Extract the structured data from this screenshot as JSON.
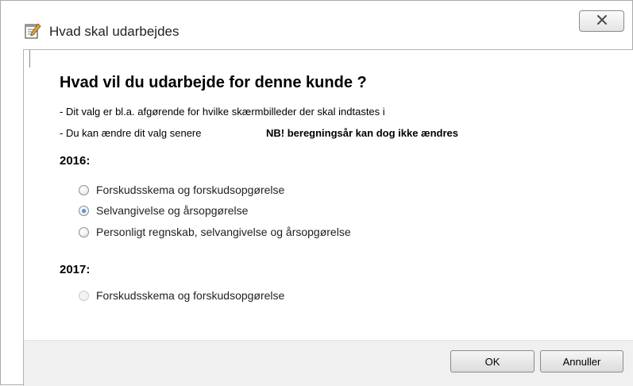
{
  "window": {
    "title": "Hvad skal udarbejdes",
    "close_icon": "close-icon",
    "app_icon": "notepad-edit-icon"
  },
  "content": {
    "heading": "Hvad vil du udarbejde for denne kunde ?",
    "info_line1": "- Dit valg er bl.a. afgørende for hvilke skærmbilleder der skal indtastes i",
    "info_line2": "- Du kan ændre dit valg senere",
    "nb_note": "NB! beregningsår kan dog ikke ændres"
  },
  "years": [
    {
      "label": "2016:",
      "options": [
        {
          "label": "Forskudsskema og forskudsopgørelse",
          "selected": false,
          "enabled": true
        },
        {
          "label": "Selvangivelse og årsopgørelse",
          "selected": true,
          "enabled": true
        },
        {
          "label": "Personligt regnskab, selvangivelse og årsopgørelse",
          "selected": false,
          "enabled": true
        }
      ]
    },
    {
      "label": "2017:",
      "options": [
        {
          "label": "Forskudsskema og forskudsopgørelse",
          "selected": false,
          "enabled": false
        }
      ]
    }
  ],
  "buttons": {
    "ok": "OK",
    "cancel": "Annuller"
  },
  "colors": {
    "radio_selected": "#1d5fa8",
    "footer_bg": "#f0f0f0"
  }
}
